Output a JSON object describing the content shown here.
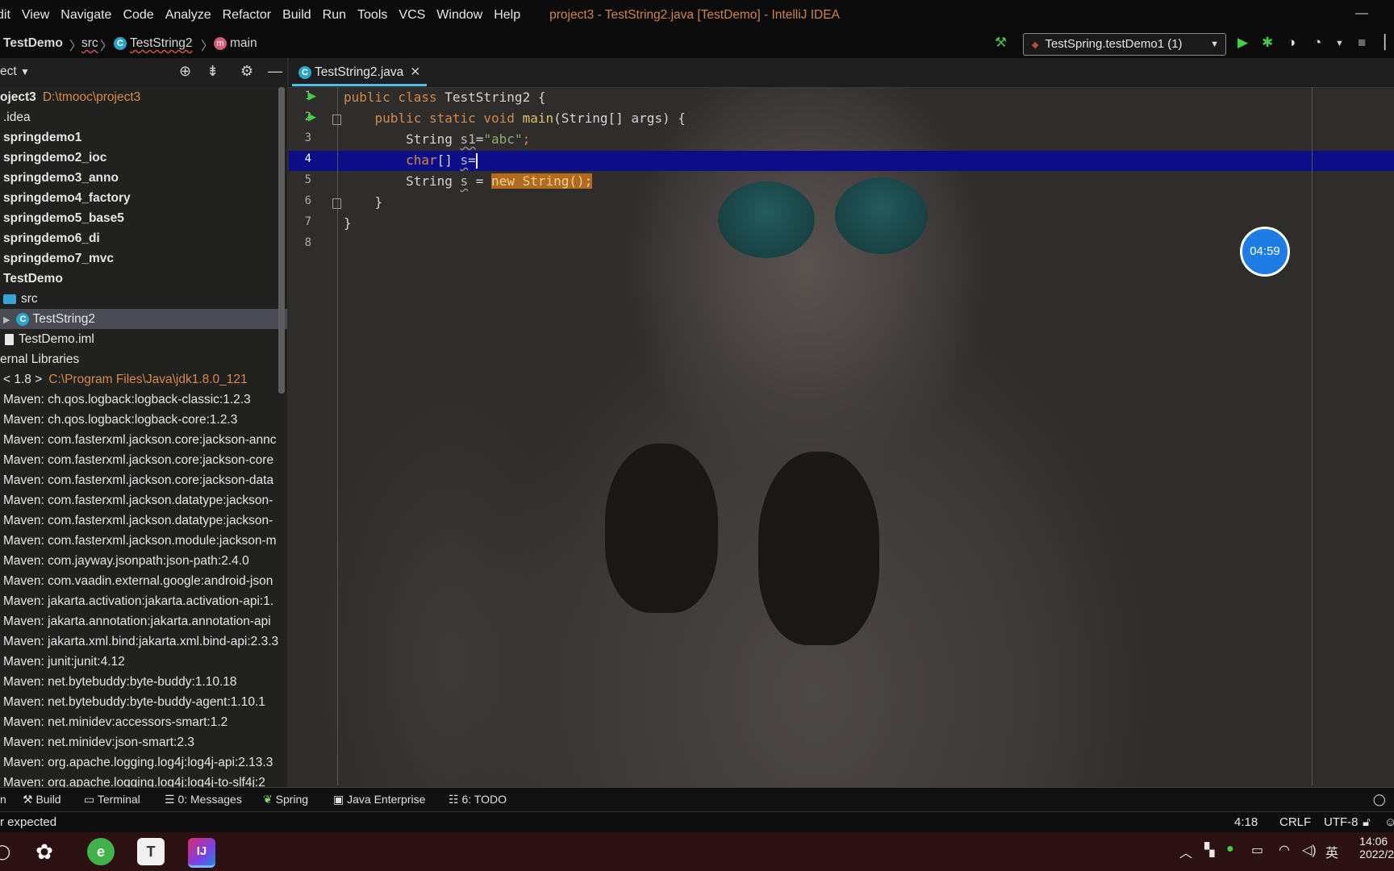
{
  "menu": {
    "items": [
      "dit",
      "View",
      "Navigate",
      "Code",
      "Analyze",
      "Refactor",
      "Build",
      "Run",
      "Tools",
      "VCS",
      "Window",
      "Help"
    ],
    "window_title": "project3 - TestString2.java [TestDemo] - IntelliJ IDEA"
  },
  "breadcrumb": {
    "project": "TestDemo",
    "folder": "src",
    "class": "TestString2",
    "method": "main",
    "class_icon": "C",
    "method_icon": "m"
  },
  "toolbar": {
    "run_config": "TestSpring.testDemo1 (1)"
  },
  "project_panel": {
    "title": "ect",
    "tree": [
      {
        "label": "oject3",
        "path": "D:\\tmooc\\project3",
        "bold": true,
        "indent": 0
      },
      {
        "label": ".idea",
        "bold": false,
        "indent": 4
      },
      {
        "label": "springdemo1",
        "bold": true,
        "indent": 4
      },
      {
        "label": "springdemo2_ioc",
        "bold": true,
        "indent": 4
      },
      {
        "label": "springdemo3_anno",
        "bold": true,
        "indent": 4
      },
      {
        "label": "springdemo4_factory",
        "bold": true,
        "indent": 4
      },
      {
        "label": "springdemo5_base5",
        "bold": true,
        "indent": 4
      },
      {
        "label": "springdemo6_di",
        "bold": true,
        "indent": 4
      },
      {
        "label": "springdemo7_mvc",
        "bold": true,
        "indent": 4
      },
      {
        "label": "TestDemo",
        "bold": true,
        "indent": 4
      },
      {
        "label": "src",
        "bold": false,
        "indent": 4,
        "icon": "folder"
      },
      {
        "label": "TestString2",
        "bold": false,
        "indent": 4,
        "icon": "class",
        "selected": true
      },
      {
        "label": "TestDemo.iml",
        "bold": false,
        "indent": 4,
        "icon": "file"
      },
      {
        "label": "ernal Libraries",
        "bold": false,
        "indent": 0
      },
      {
        "label": "< 1.8 >",
        "path": "C:\\Program Files\\Java\\jdk1.8.0_121",
        "bold": false,
        "indent": 4
      },
      {
        "label": "Maven: ch.qos.logback:logback-classic:1.2.3",
        "indent": 4
      },
      {
        "label": "Maven: ch.qos.logback:logback-core:1.2.3",
        "indent": 4
      },
      {
        "label": "Maven: com.fasterxml.jackson.core:jackson-annc",
        "indent": 4
      },
      {
        "label": "Maven: com.fasterxml.jackson.core:jackson-core",
        "indent": 4
      },
      {
        "label": "Maven: com.fasterxml.jackson.core:jackson-data",
        "indent": 4
      },
      {
        "label": "Maven: com.fasterxml.jackson.datatype:jackson-",
        "indent": 4
      },
      {
        "label": "Maven: com.fasterxml.jackson.datatype:jackson-",
        "indent": 4
      },
      {
        "label": "Maven: com.fasterxml.jackson.module:jackson-m",
        "indent": 4
      },
      {
        "label": "Maven: com.jayway.jsonpath:json-path:2.4.0",
        "indent": 4
      },
      {
        "label": "Maven: com.vaadin.external.google:android-json",
        "indent": 4
      },
      {
        "label": "Maven: jakarta.activation:jakarta.activation-api:1.",
        "indent": 4
      },
      {
        "label": "Maven: jakarta.annotation:jakarta.annotation-api",
        "indent": 4
      },
      {
        "label": "Maven: jakarta.xml.bind:jakarta.xml.bind-api:2.3.3",
        "indent": 4
      },
      {
        "label": "Maven: junit:junit:4.12",
        "indent": 4
      },
      {
        "label": "Maven: net.bytebuddy:byte-buddy:1.10.18",
        "indent": 4
      },
      {
        "label": "Maven: net.bytebuddy:byte-buddy-agent:1.10.1",
        "indent": 4
      },
      {
        "label": "Maven: net.minidev:accessors-smart:1.2",
        "indent": 4
      },
      {
        "label": "Maven: net.minidev:json-smart:2.3",
        "indent": 4
      },
      {
        "label": "Maven: org.apache.logging.log4j:log4j-api:2.13.3",
        "indent": 4
      },
      {
        "label": "Maven: org.apache.logging.log4j:log4j-to-slf4j:2",
        "indent": 4
      }
    ]
  },
  "editor": {
    "tab_label": "TestString2.java",
    "line_numbers": [
      "1",
      "2",
      "3",
      "4",
      "5",
      "6",
      "7",
      "8"
    ],
    "code": {
      "l1_kw": "public class ",
      "l1_name": "TestString2 {",
      "l2_kw": "public static void ",
      "l2_fn": "main",
      "l2_rest": "(String[] args) {",
      "l3_type": "String ",
      "l3_var": "s1",
      "l3_eq": "=",
      "l3_str": "\"abc\"",
      "l3_end": ";",
      "l4_kw": "char",
      "l4_rest": "[] ",
      "l4_var": "s",
      "l4_eq": "=",
      "l5_type": "String ",
      "l5_var": "s",
      "l5_eq": " = ",
      "l5_hl_kw": "new ",
      "l5_hl_rest": "String();",
      "l6": "}",
      "l7": "}"
    }
  },
  "timer": {
    "text": "04:59"
  },
  "tool_windows": [
    {
      "label": "n",
      "icon": ""
    },
    {
      "label": "Build",
      "icon": "hammer-icon"
    },
    {
      "label": "Terminal",
      "icon": "terminal-icon"
    },
    {
      "label": "0: Messages",
      "icon": "messages-icon"
    },
    {
      "label": "Spring",
      "icon": "spring-icon"
    },
    {
      "label": "Java Enterprise",
      "icon": "java-enterprise-icon"
    },
    {
      "label": "6: TODO",
      "icon": "todo-icon"
    }
  ],
  "status": {
    "message": "r expected",
    "position": "4:18",
    "line_sep": "CRLF",
    "encoding": "UTF-8"
  },
  "taskbar": {
    "ime": "英",
    "time": "14:06",
    "date": "2022/2"
  },
  "colors": {
    "accent_tab": "#4ec0e8",
    "current_line": "#0d0d88",
    "keyword": "#d08b48",
    "string": "#8fae6f",
    "path": "#d88a46",
    "timer_blue": "#1e7ce6"
  }
}
